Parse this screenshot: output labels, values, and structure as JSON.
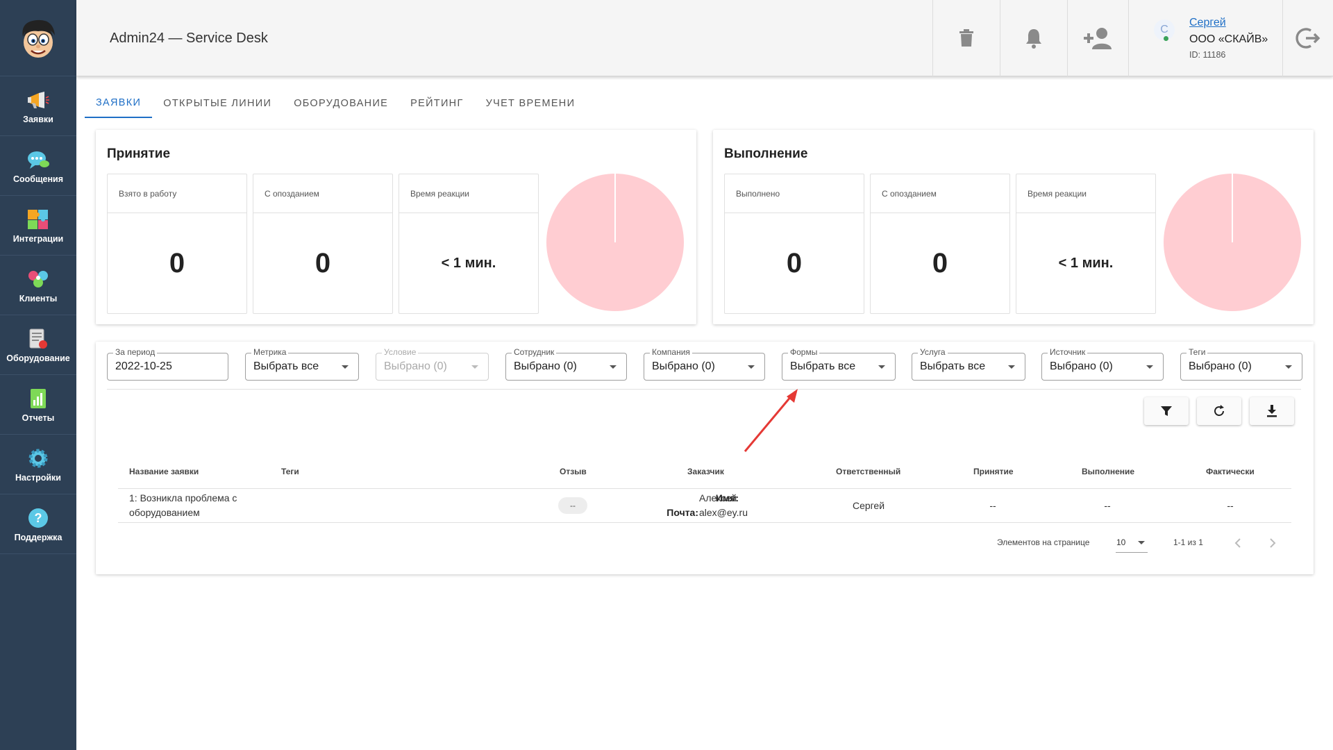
{
  "app": {
    "title": "Admin24 — Service Desk"
  },
  "sidebar": {
    "items": [
      {
        "label": "Заявки",
        "icon": "megaphone-icon"
      },
      {
        "label": "Сообщения",
        "icon": "chat-bubble-icon"
      },
      {
        "label": "Интеграции",
        "icon": "puzzle-icon"
      },
      {
        "label": "Клиенты",
        "icon": "clients-icon"
      },
      {
        "label": "Оборудование",
        "icon": "equipment-icon"
      },
      {
        "label": "Отчеты",
        "icon": "report-chart-icon"
      },
      {
        "label": "Настройки",
        "icon": "gear-icon"
      },
      {
        "label": "Поддержка",
        "icon": "help-icon"
      }
    ]
  },
  "user": {
    "avatar_letter": "С",
    "name": "Сергей",
    "company": "ООО «СКАЙВ»",
    "id": "ID: 11186",
    "status_color": "#3aa25a"
  },
  "tabs": [
    "ЗАЯВКИ",
    "ОТКРЫТЫЕ ЛИНИИ",
    "ОБОРУДОВАНИЕ",
    "РЕЙТИНГ",
    "УЧЕТ ВРЕМЕНИ"
  ],
  "acceptance": {
    "title": "Принятие",
    "metrics": [
      {
        "label": "Взято в работу",
        "value": "0"
      },
      {
        "label": "С опозданием",
        "value": "0"
      },
      {
        "label": "Время реакции",
        "value": "< 1 мин."
      }
    ]
  },
  "execution": {
    "title": "Выполнение",
    "metrics": [
      {
        "label": "Выполнено",
        "value": "0"
      },
      {
        "label": "С опозданием",
        "value": "0"
      },
      {
        "label": "Время реакции",
        "value": "< 1 мин."
      }
    ]
  },
  "filters": {
    "period": {
      "label": "За период",
      "value": "2022-10-25"
    },
    "metric": {
      "label": "Метрика",
      "value": "Выбрать все"
    },
    "condition": {
      "label": "Условие",
      "value": "Выбрано (0)"
    },
    "employee": {
      "label": "Сотрудник",
      "value": "Выбрано (0)"
    },
    "company": {
      "label": "Компания",
      "value": "Выбрано (0)"
    },
    "forms": {
      "label": "Формы",
      "value": "Выбрать все"
    },
    "service": {
      "label": "Услуга",
      "value": "Выбрать все"
    },
    "source": {
      "label": "Источник",
      "value": "Выбрано (0)"
    },
    "tags": {
      "label": "Теги",
      "value": "Выбрано (0)"
    }
  },
  "table": {
    "headers": [
      "Название заявки",
      "Теги",
      "Отзыв",
      "Заказчик",
      "Ответственный",
      "Принятие",
      "Выполнение",
      "Фактически"
    ],
    "rows": [
      {
        "title_line1": "1: Возникла проблема с",
        "title_line2": "оборудованием",
        "feedback": "--",
        "customer_name_label": "Имя:",
        "customer_name": "Алексей",
        "customer_email_label": "Почта:",
        "customer_email": "alex@ey.ru",
        "responsible": "Сергей",
        "acceptance": "--",
        "execution": "--",
        "actual": "--"
      }
    ]
  },
  "pagination": {
    "per_page_label": "Элементов на странице",
    "per_page": "10",
    "range": "1-1 из 1"
  },
  "colors": {
    "sidebar": "#2d4055",
    "accent": "#1f6fc6",
    "pie": "#ffcdd2",
    "arrow": "#e53935"
  }
}
